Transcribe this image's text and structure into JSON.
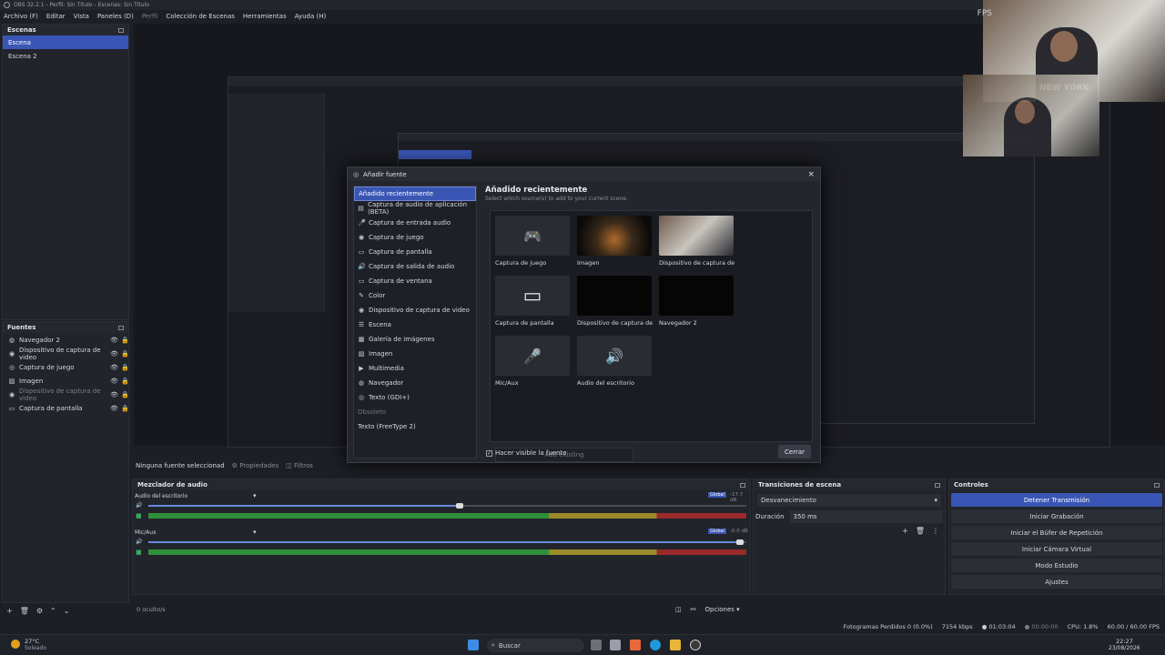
{
  "window": {
    "title": "OBS 32.2.1 - Perfil: Sin Título - Escenas: Sin Título",
    "fps": "FPS"
  },
  "menu": [
    "Archivo (F)",
    "Editar",
    "Vista",
    "Paneles (D)",
    "Perfil",
    "Colección de Escenas",
    "Herramientas",
    "Ayuda (H)"
  ],
  "scenes": {
    "title": "Escenas",
    "items": [
      "Escena",
      "Escena 2"
    ]
  },
  "sources": {
    "title": "Fuentes",
    "items": [
      {
        "label": "Navegador 2",
        "dim": false,
        "icon": "globe-icon"
      },
      {
        "label": "Dispositivo de captura de video",
        "dim": false,
        "icon": "camera-icon"
      },
      {
        "label": "Captura de juego",
        "dim": false,
        "icon": "gamepad-icon"
      },
      {
        "label": "Imagen",
        "dim": false,
        "icon": "image-icon"
      },
      {
        "label": "Dispositivo de captura de video",
        "dim": true,
        "icon": "camera-icon"
      },
      {
        "label": "Captura de pantalla",
        "dim": false,
        "icon": "monitor-icon"
      }
    ]
  },
  "dialog": {
    "title": "Añadir fuente",
    "list": [
      {
        "label": "Añadido recientemente",
        "sel": true,
        "icon": ""
      },
      {
        "label": "Captura de audio de aplicación (BETA)",
        "icon": "▤"
      },
      {
        "label": "Captura de entrada audio",
        "icon": "🎤"
      },
      {
        "label": "Captura de juego",
        "icon": "◉"
      },
      {
        "label": "Captura de pantalla",
        "icon": "▭"
      },
      {
        "label": "Captura de salida de audio",
        "icon": "🔊"
      },
      {
        "label": "Captura de ventana",
        "icon": "▭"
      },
      {
        "label": "Color",
        "icon": "✎"
      },
      {
        "label": "Dispositivo de captura de video",
        "icon": "◉"
      },
      {
        "label": "Escena",
        "icon": "☰"
      },
      {
        "label": "Galería de imágenes",
        "icon": "▦"
      },
      {
        "label": "Imagen",
        "icon": "▨"
      },
      {
        "label": "Multimedia",
        "icon": "▶"
      },
      {
        "label": "Navegador",
        "icon": "◍"
      },
      {
        "label": "Texto (GDI+)",
        "icon": "◎"
      },
      {
        "label": "Obsoleto",
        "hdr": true,
        "icon": ""
      },
      {
        "label": "Texto (FreeType 2)",
        "icon": ""
      }
    ],
    "heading": "Añadido recientemente",
    "subheading": "Select which source(s) to add to your current scene.",
    "cards": [
      {
        "label": "Captura de juego",
        "kind": "gamepad"
      },
      {
        "label": "Imagen",
        "kind": "image-dark"
      },
      {
        "label": "Dispositivo de captura de v",
        "kind": "webcam"
      },
      {
        "label": "Captura de pantalla",
        "kind": "monitor"
      },
      {
        "label": "Dispositivo de captura de v",
        "kind": "black"
      },
      {
        "label": "Navegador 2",
        "kind": "black"
      },
      {
        "label": "Mic/Aux",
        "kind": "mic"
      },
      {
        "label": "Audio del escritorio",
        "kind": "speaker"
      }
    ],
    "add_existing": "Add existing",
    "checkbox": "Hacer visible la fuente",
    "close": "Cerrar"
  },
  "selection_bar": {
    "text": "Ninguna fuente seleccionad",
    "props": "Propiedades",
    "filters": "Filtros"
  },
  "mixer": {
    "title": "Mezclador de audio",
    "channels": [
      {
        "name": "Audio del escritorio",
        "level": "-17.7 dB",
        "vol": 0.52
      },
      {
        "name": "Mic/Aux",
        "level": "-0.0 dB",
        "vol": 0.99
      }
    ],
    "global": "Global",
    "hidden": "0 oculto/s",
    "options": "Opciones"
  },
  "transitions": {
    "title": "Transiciones de escena",
    "selected": "Desvanecimiento",
    "duration_label": "Duración",
    "duration": "350 ms"
  },
  "controls": {
    "title": "Controles",
    "buttons": [
      "Detener Transmisión",
      "Iniciar Grabación",
      "Iniciar el Búfer de Repetición",
      "Iniciar Cámara Virtual",
      "Modo Estudio",
      "Ajustes"
    ]
  },
  "status": {
    "dropped": "Fotogramas Perdidos 0 (0.0%)",
    "kbps": "7154 kbps",
    "stream_time": "01:03:04",
    "rec_time": "00:00:00",
    "cpu": "CPU: 1.8%",
    "fps": "60.00 / 60.00 FPS"
  },
  "taskbar": {
    "weather_temp": "27°C",
    "weather_desc": "Soleado",
    "search": "Buscar",
    "time": "22:27",
    "date": "23/08/2026"
  }
}
